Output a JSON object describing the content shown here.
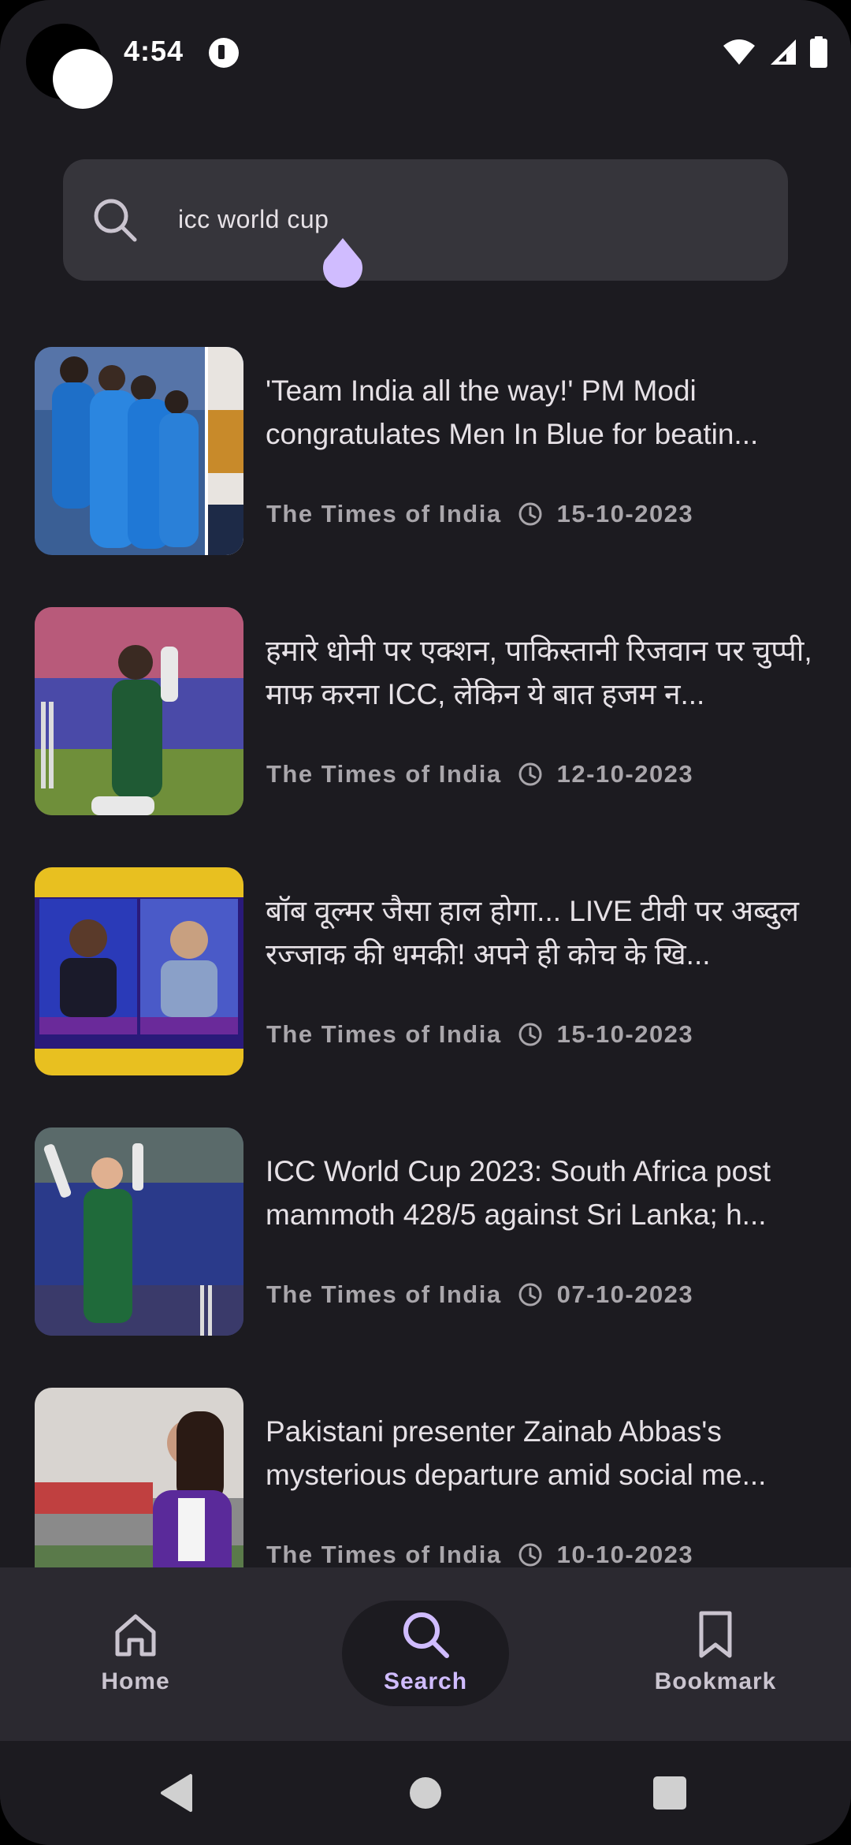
{
  "status_bar": {
    "time": "4:54"
  },
  "search": {
    "value": "icc world cup",
    "placeholder": "Search"
  },
  "news": [
    {
      "title": "'Team India all the way!' PM Modi congratulates Men In Blue for beatin...",
      "source": "The Times of India",
      "date": "15-10-2023",
      "thumbnail": "cricket-team-celebration"
    },
    {
      "title": "हमारे धोनी पर एक्शन, पाकिस्तानी रिजवान पर चुप्पी, माफ करना ICC, लेकिन ये बात हजम न...",
      "source": "The Times of India",
      "date": "12-10-2023",
      "thumbnail": "batsman-celebrating"
    },
    {
      "title": "बॉब वूल्मर जैसा हाल होगा... LIVE टीवी पर अब्दुल रज्जाक की धमकी! अपने ही कोच के खि...",
      "source": "The Times of India",
      "date": "15-10-2023",
      "thumbnail": "tv-panel-broadcast"
    },
    {
      "title": "ICC World Cup 2023: South Africa post mammoth 428/5 against Sri Lanka; h...",
      "source": "The Times of India",
      "date": "07-10-2023",
      "thumbnail": "batsman-raising-bat"
    },
    {
      "title": "Pakistani presenter Zainab Abbas's mysterious departure amid social me...",
      "source": "The Times of India",
      "date": "10-10-2023",
      "thumbnail": "presenter-in-stadium"
    }
  ],
  "bottom_nav": {
    "items": [
      {
        "label": "Home",
        "icon": "home-icon"
      },
      {
        "label": "Search",
        "icon": "search-icon",
        "active": true
      },
      {
        "label": "Bookmark",
        "icon": "bookmark-icon"
      }
    ]
  },
  "colors": {
    "background": "#1c1b20",
    "search_bar": "#36353b",
    "bottom_nav": "#2b2930",
    "accent": "#d0bcff",
    "text_primary": "#e6e1e6",
    "text_secondary": "#a9a6ab"
  }
}
